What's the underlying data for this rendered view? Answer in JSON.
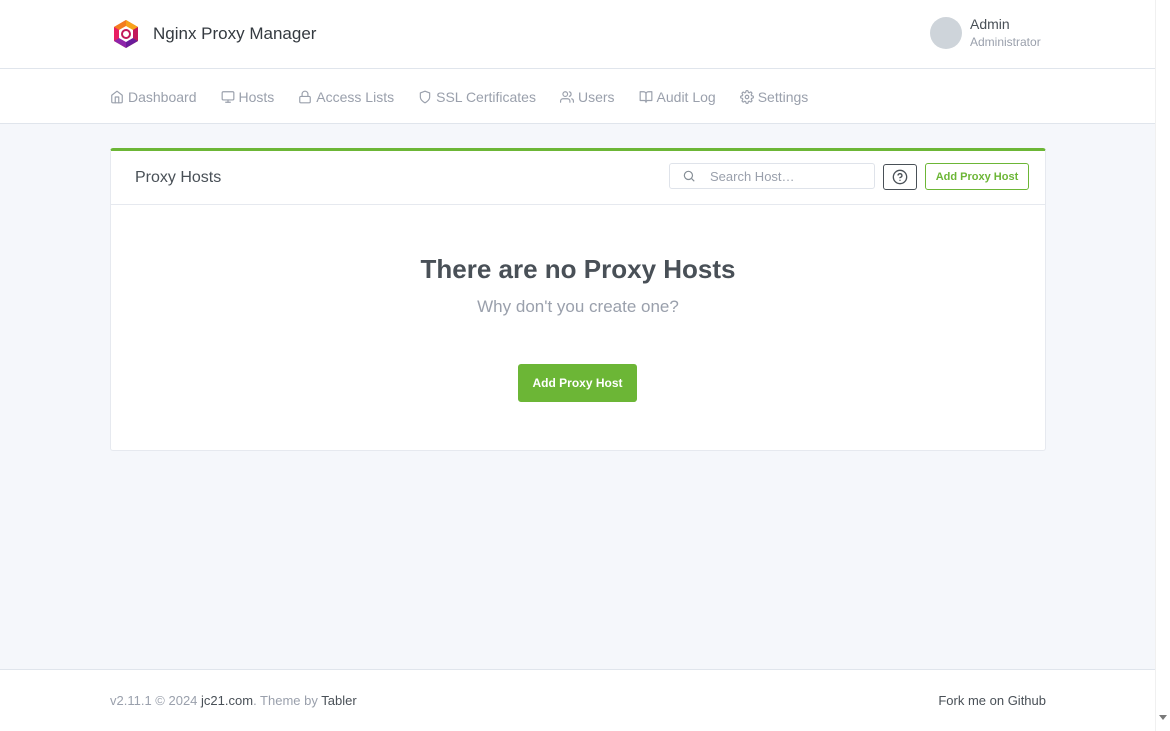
{
  "brand": {
    "name": "Nginx Proxy Manager",
    "logo_icon": "npm-hexagon-logo-icon"
  },
  "user": {
    "name": "Admin",
    "role": "Administrator"
  },
  "nav": {
    "items": [
      {
        "label": "Dashboard",
        "icon": "home-icon"
      },
      {
        "label": "Hosts",
        "icon": "monitor-icon"
      },
      {
        "label": "Access Lists",
        "icon": "lock-icon"
      },
      {
        "label": "SSL Certificates",
        "icon": "shield-icon"
      },
      {
        "label": "Users",
        "icon": "users-icon"
      },
      {
        "label": "Audit Log",
        "icon": "book-open-icon"
      },
      {
        "label": "Settings",
        "icon": "settings-icon"
      }
    ]
  },
  "card": {
    "title": "Proxy Hosts",
    "search_placeholder": "Search Host…",
    "help_icon": "help-circle-icon",
    "add_button_label": "Add Proxy Host",
    "accent_color": "#6cb636",
    "empty": {
      "title": "There are no Proxy Hosts",
      "subtitle": "Why don't you create one?",
      "button_label": "Add Proxy Host"
    }
  },
  "footer": {
    "version": "v2.11.1 © 2024",
    "site_link": "jc21.com",
    "theme_text": ". Theme by",
    "theme_link": "Tabler",
    "fork_link": "Fork me on Github"
  }
}
